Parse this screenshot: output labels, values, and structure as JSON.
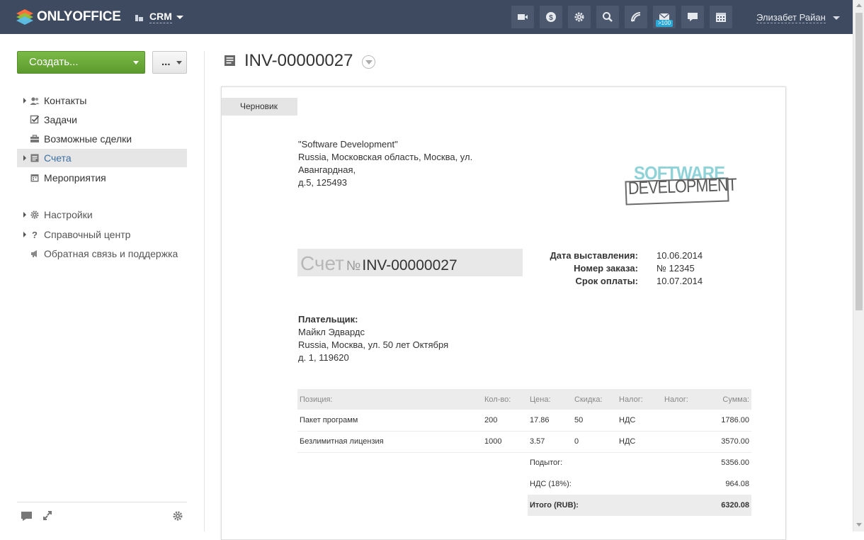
{
  "header": {
    "logo_text": "ONLYOFFICE",
    "module": "CRM",
    "tools": [
      {
        "icon": "video-icon"
      },
      {
        "icon": "dollar-icon"
      },
      {
        "icon": "gear-icon"
      },
      {
        "icon": "search-icon"
      },
      {
        "icon": "feed-icon"
      },
      {
        "icon": "mail-icon",
        "badge": ">100"
      },
      {
        "icon": "chat-icon"
      },
      {
        "icon": "calendar-icon"
      }
    ],
    "user_name": "Элизабет Райан"
  },
  "sidebar": {
    "create_label": "Создать...",
    "more_label": "...",
    "items": [
      {
        "label": "Контакты",
        "icon": "contacts-icon",
        "expandable": true
      },
      {
        "label": "Задачи",
        "icon": "tasks-icon",
        "expandable": false
      },
      {
        "label": "Возможные сделки",
        "icon": "deals-icon",
        "expandable": false
      },
      {
        "label": "Счета",
        "icon": "invoices-icon",
        "expandable": true,
        "active": true
      },
      {
        "label": "Мероприятия",
        "icon": "events-icon",
        "expandable": false
      }
    ],
    "secondary": [
      {
        "label": "Настройки",
        "icon": "settings-icon"
      },
      {
        "label": "Справочный центр",
        "icon": "help-icon"
      },
      {
        "label": "Обратная связь и поддержка",
        "icon": "feedback-icon"
      }
    ]
  },
  "page": {
    "title": "INV-00000027"
  },
  "invoice": {
    "status": "Черновик",
    "company_lines": [
      "\"Software Development\"",
      "Russia, Московская область, Москва, ул.",
      "Авангардная,",
      "д.5, 125493"
    ],
    "logo_top": "SOFTWARE",
    "logo_bottom": "DEVELOPMENT",
    "heading_word": "Счет",
    "heading_no": "№",
    "number": "INV-00000027",
    "meta": [
      {
        "label": "Дата выставления:",
        "value": "10.06.2014"
      },
      {
        "label": "Номер заказа:",
        "value": "№ 12345"
      },
      {
        "label": "Срок оплаты:",
        "value": "10.07.2014"
      }
    ],
    "payer_heading": "Плательщик:",
    "payer_lines": [
      "Майкл Эдвардс",
      "Russia, Москва, ул. 50 лет Октября",
      "д. 1, 119620"
    ],
    "columns": [
      "Позиция:",
      "Кол-во:",
      "Цена:",
      "Скидка:",
      "Налог:",
      "Налог:",
      "Сумма:"
    ],
    "rows": [
      [
        "Пакет программ",
        "200",
        "17.86",
        "50",
        "НДС",
        "",
        "1786.00"
      ],
      [
        "Безлимитная лицензия",
        "1000",
        "3.57",
        "0",
        "НДС",
        "",
        "3570.00"
      ]
    ],
    "subtotal_label": "Подытог:",
    "subtotal_value": "5356.00",
    "tax_label": "НДС (18%):",
    "tax_value": "964.08",
    "total_label": "Итого (RUB):",
    "total_value": "6320.08"
  }
}
